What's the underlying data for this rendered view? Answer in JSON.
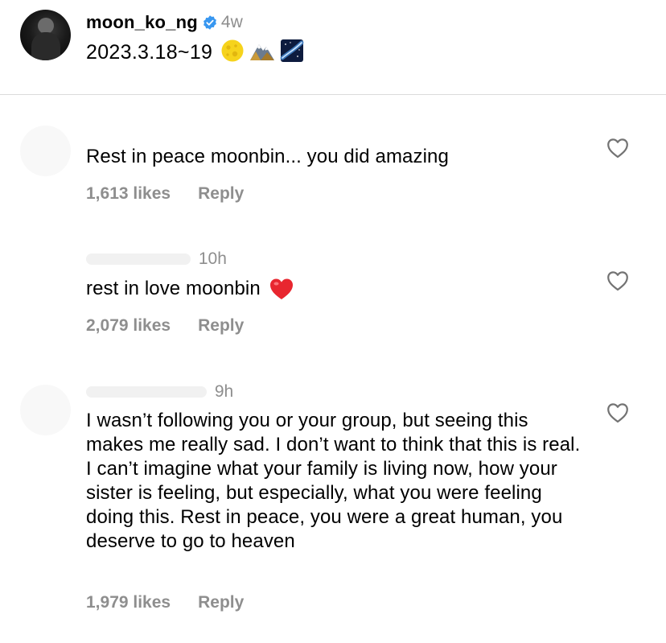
{
  "post": {
    "username": "moon_ko_ng",
    "verified_icon": "verified-badge-icon",
    "time_ago": "4w",
    "caption_text": "2023.3.18~19",
    "caption_emojis": [
      "full-moon-icon",
      "mountain-icon",
      "milky-way-icon"
    ]
  },
  "comments": [
    {
      "time_ago": "",
      "text": "Rest in peace moonbin... you did amazing",
      "likes": "1,613 likes",
      "reply_label": "Reply",
      "like_icon": "heart-outline-icon"
    },
    {
      "time_ago": "10h",
      "text": "rest in love moonbin",
      "text_emoji": "red-heart-icon",
      "likes": "2,079 likes",
      "reply_label": "Reply",
      "like_icon": "heart-outline-icon"
    },
    {
      "time_ago": "9h",
      "text": "I wasn’t following you or your group, but seeing this makes me really sad. I don’t want to think that this is real. I can’t imagine what your family is living now, how your sister is feeling, but especially, what you were feeling doing this. Rest in peace, you were a great human, you deserve to go to heaven",
      "likes": "1,979 likes",
      "reply_label": "Reply",
      "like_icon": "heart-outline-icon"
    }
  ],
  "colors": {
    "primary_text": "#000000",
    "secondary_text": "#8e8e8e",
    "verified_blue": "#3897f0",
    "divider": "#dbdbdb",
    "heart_red": "#e0245e"
  }
}
